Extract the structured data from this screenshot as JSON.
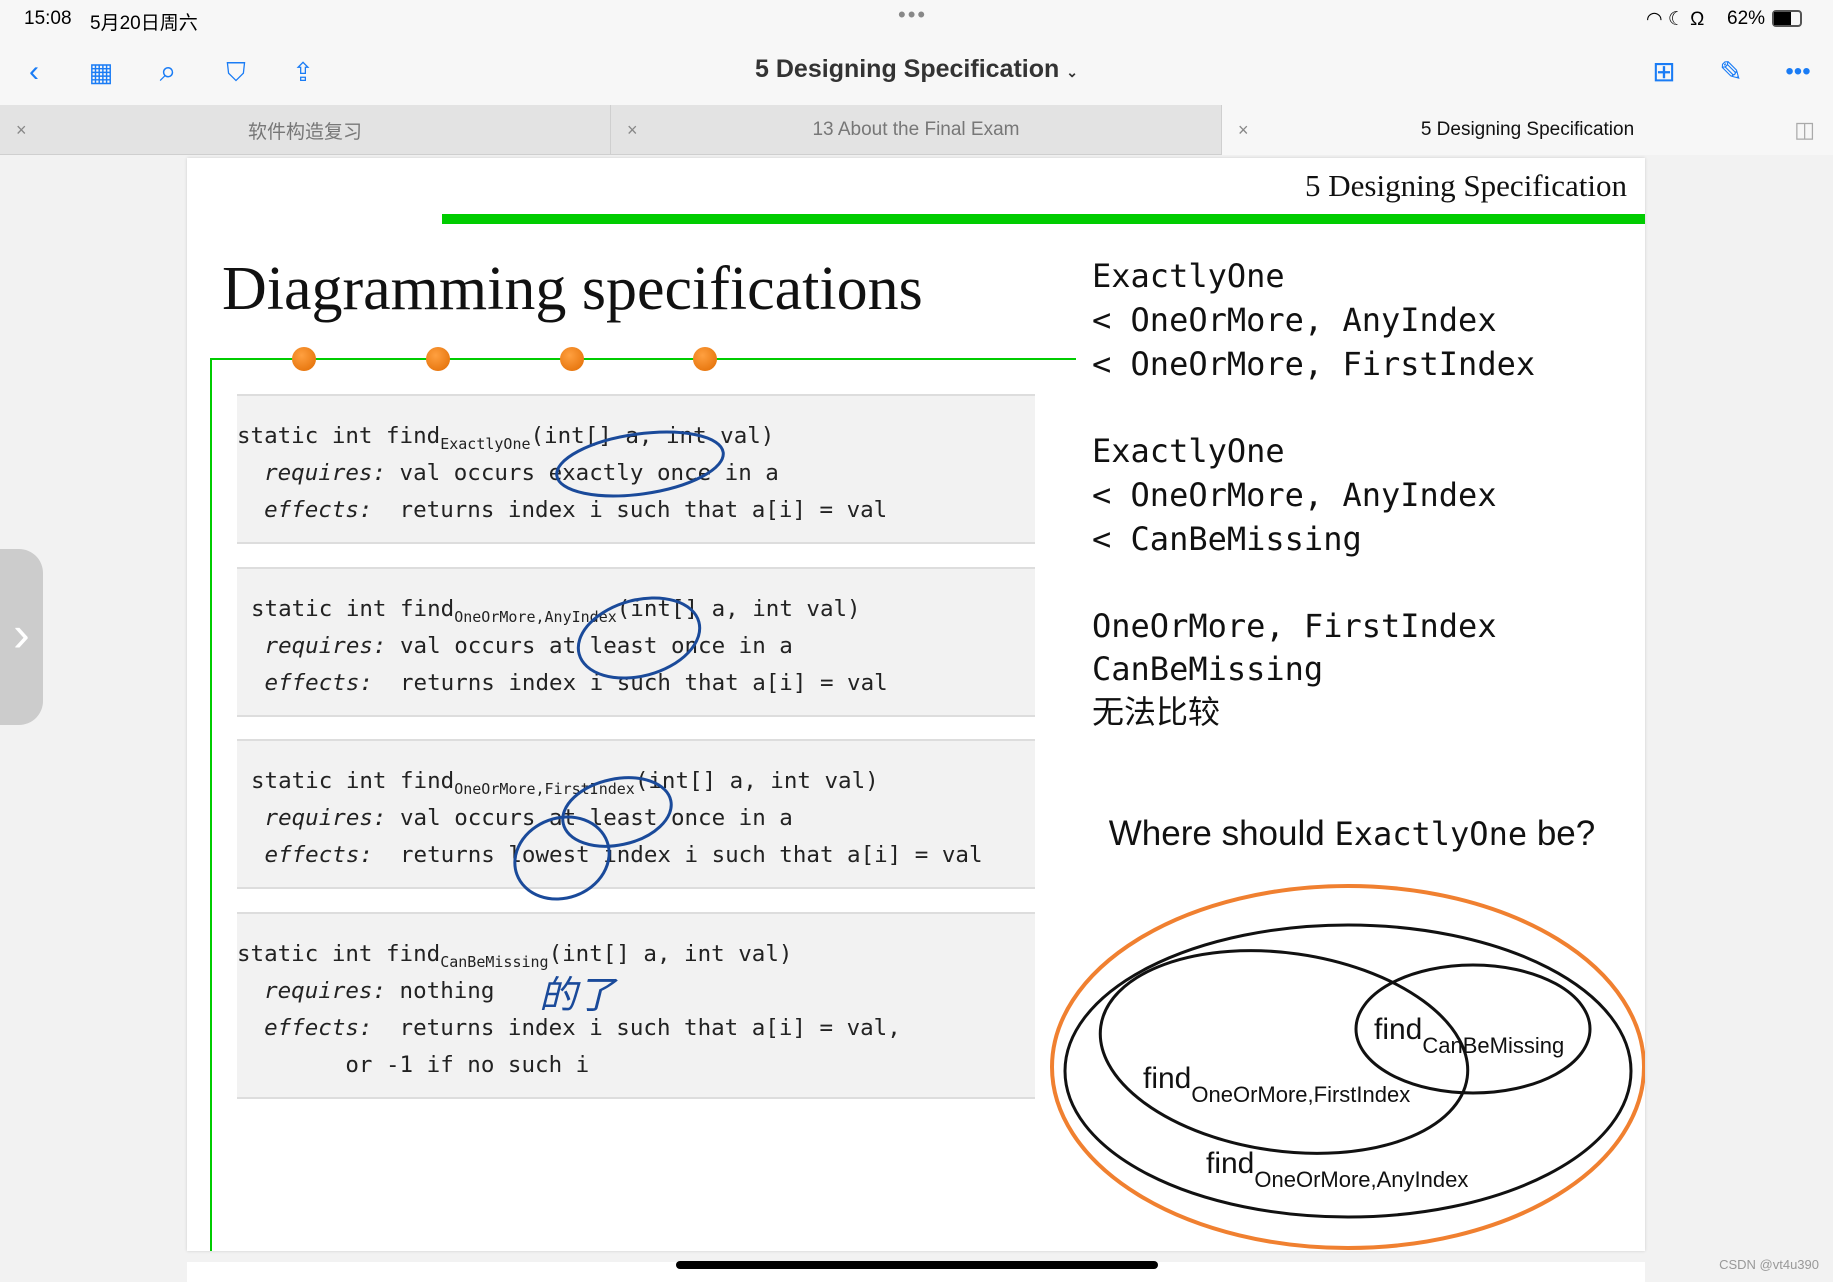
{
  "status": {
    "time": "15:08",
    "date": "5月20日周六",
    "battery": "62%"
  },
  "toolbar": {
    "title": "5 Designing Specification",
    "icons": [
      "back-icon",
      "grid-icon",
      "search-icon",
      "bookmark-icon",
      "share-icon",
      "add-page-icon",
      "pencil-icon",
      "more-icon"
    ]
  },
  "tabs": [
    {
      "label": "软件构造复习"
    },
    {
      "label": "13 About the Final Exam"
    },
    {
      "label": "5 Designing Specification",
      "active": true
    }
  ],
  "slide": {
    "header": "5 Designing Specification",
    "title": "Diagramming specifications",
    "specs": [
      {
        "sig_pre": "static int find",
        "sub": "ExactlyOne",
        "sig_post": "(int[] a, int val)",
        "requires_label": "requires:",
        "requires": " val occurs exactly once in a",
        "effects_label": "effects:",
        "effects": "  returns index i such that a[i] = val"
      },
      {
        "sig_pre": "static int find",
        "sub": "OneOrMore,AnyIndex",
        "sig_post": "(int[] a, int val)",
        "requires_label": "requires:",
        "requires": " val occurs at least once in a",
        "effects_label": "effects:",
        "effects": "  returns index i such that a[i] = val"
      },
      {
        "sig_pre": "static int find",
        "sub": "OneOrMore,FirstIndex",
        "sig_post": "(int[] a, int val)",
        "requires_label": "requires:",
        "requires": " val occurs at least once in a",
        "effects_label": "effects:",
        "effects": "  returns lowest index i such that a[i] = val"
      },
      {
        "sig_pre": "static int find",
        "sub": "CanBeMissing",
        "sig_post": "(int[] a, int val)",
        "requires_label": "requires:",
        "requires": " nothing",
        "effects_label": "effects:",
        "effects": "  returns index i such that a[i] = val,",
        "effects2": "or -1 if no such i"
      }
    ],
    "handwriting": "的了",
    "comparisons": [
      [
        "ExactlyOne",
        "< OneOrMore, AnyIndex",
        "< OneOrMore, FirstIndex"
      ],
      [
        "ExactlyOne",
        "< OneOrMore, AnyIndex",
        "< CanBeMissing"
      ],
      [
        "OneOrMore, FirstIndex",
        "CanBeMissing",
        "无法比较"
      ]
    ],
    "question_pre": "Where should ",
    "question_code": "ExactlyOne",
    "question_post": " be?",
    "venn": {
      "find": "find",
      "canbe": "CanBeMissing",
      "first": "OneOrMore,FirstIndex",
      "any": "OneOrMore,AnyIndex"
    },
    "colors": {
      "accent_green": "#00cc00",
      "orange": "#f08030",
      "ink_blue": "#1a4a9a"
    }
  },
  "watermark": "CSDN @vt4u390"
}
